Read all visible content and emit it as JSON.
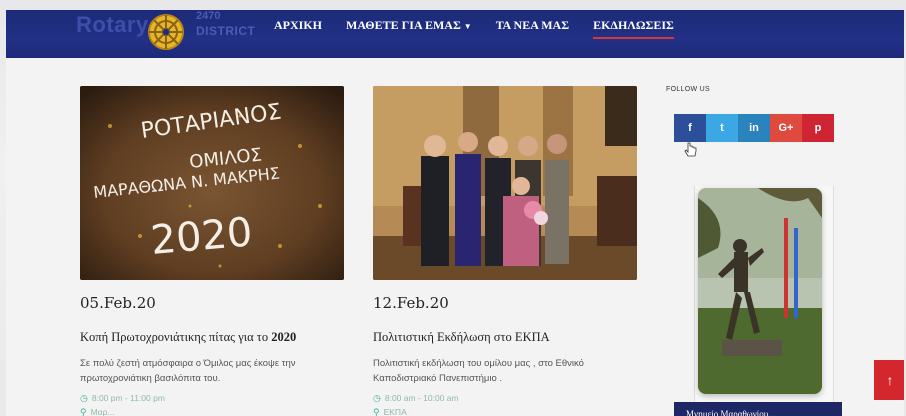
{
  "brand": {
    "name": "Rotary",
    "district_number": "2470",
    "district_label": "DISTRICT"
  },
  "nav": {
    "items": [
      {
        "label": "ΑΡΧΙΚΗ"
      },
      {
        "label": "ΜΑΘΕΤΕ ΓΙΑ ΕΜΑΣ"
      },
      {
        "label": "ΤΑ ΝΕΑ ΜΑΣ"
      },
      {
        "label": "ΕΚΔΗΛΩΣΕΙΣ"
      }
    ],
    "active": "ΕΚΔΗΛΩΣΕΙΣ",
    "dropdown_icon": "caret-down-icon"
  },
  "posts": [
    {
      "image_caption_lines": [
        "ΡΟΤΑΡΙΑΝΟΣ",
        "ΟΜΙΛΟΣ",
        "ΜΑΡΑΘΩΝΑ Ν. ΜΑΚΡΗΣ",
        "2020"
      ],
      "date": "05.Feb.20",
      "title_prefix": "Κοπή Πρωτοχρονιάτικης πίτας για το ",
      "title_bold": "2020",
      "excerpt": "Σε πολύ ζεστή ατμόσφαιρα ο Όμιλος μας έκοψε την πρωτοχρονιάτικη βασιλόπιτα του.",
      "time": "8:00 pm - 11:00 pm",
      "location": "Μαρ..."
    },
    {
      "date": "12.Feb.20",
      "title_prefix": "Πολιτιστική Εκδήλωση στο ΕΚΠΑ",
      "title_bold": "",
      "excerpt": "Πολιτιστική εκδήλωση του ομίλου μας , στο Εθνικό Καποδιστριακό Πανεπιστήμιο .",
      "time": "8:00 am - 10:00 am",
      "location": "ΕΚΠΑ"
    }
  ],
  "sidebar": {
    "follow_label": "FOLLOW US",
    "social": [
      {
        "name": "facebook-icon",
        "glyph": "f"
      },
      {
        "name": "twitter-icon",
        "glyph": "t"
      },
      {
        "name": "linkedin-icon",
        "glyph": "in"
      },
      {
        "name": "googleplus-icon",
        "glyph": "G+"
      },
      {
        "name": "pinterest-icon",
        "glyph": "p"
      }
    ],
    "footer_text": "Μνημείο Μαραθωνίου..."
  },
  "scroll_top": {
    "glyph": "↑"
  },
  "colors": {
    "nav_bg": "#1f2c7e",
    "active_underline": "#d8383a",
    "meta_green": "#3cb29a",
    "scroll_top_bg": "#d3262d"
  }
}
